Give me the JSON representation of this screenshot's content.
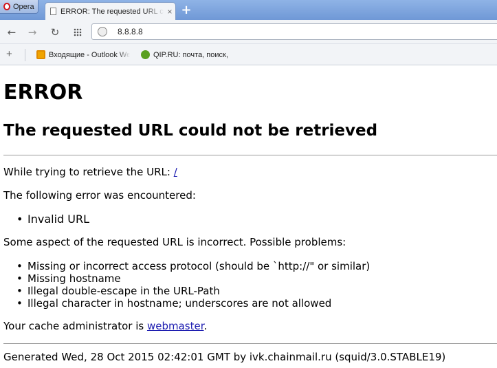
{
  "browser": {
    "menu_label": "Opera",
    "tab": {
      "title": "ERROR: The requested URL could not be retrieved",
      "close": "×"
    },
    "new_tab": "+",
    "nav": {
      "back": "←",
      "forward": "→",
      "reload": "↻"
    },
    "address": "8.8.8.8",
    "bookmarks": {
      "add": "+",
      "items": [
        {
          "label": "Входящие - Outlook Web"
        },
        {
          "label": "QIP.RU: почта, поиск,"
        }
      ]
    }
  },
  "page": {
    "title": "ERROR",
    "subtitle": "The requested URL could not be retrieved",
    "retrieve_text": "While trying to retrieve the URL: ",
    "retrieve_link": "/",
    "error_intro": "The following error was encountered:",
    "error_item": "Invalid URL",
    "problems_intro": "Some aspect of the requested URL is incorrect. Possible problems:",
    "problems": [
      "Missing or incorrect access protocol (should be `http://\" or similar)",
      "Missing hostname",
      "Illegal double-escape in the URL-Path",
      "Illegal character in hostname; underscores are not allowed"
    ],
    "admin_text": "Your cache administrator is ",
    "admin_link": "webmaster",
    "admin_end": ".",
    "footer": "Generated Wed, 28 Oct 2015 02:42:01 GMT by ivk.chainmail.ru (squid/3.0.STABLE19)"
  }
}
